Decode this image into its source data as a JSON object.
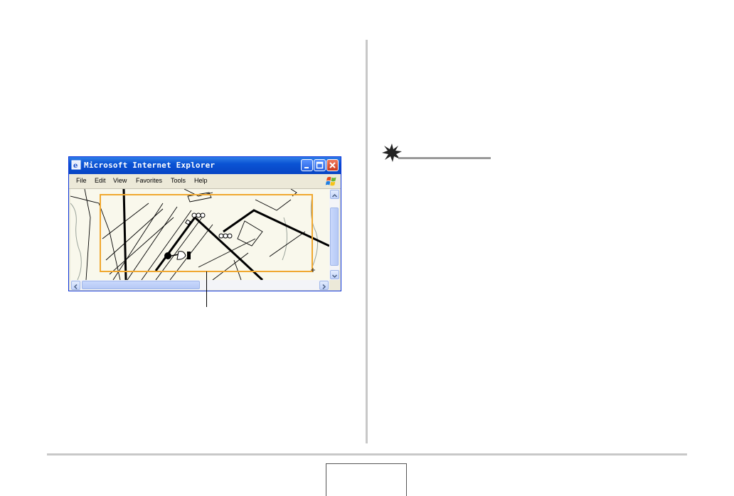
{
  "window": {
    "title": "Microsoft Internet Explorer",
    "controls": [
      "minimize-icon",
      "maximize-icon",
      "close-icon"
    ]
  },
  "menu": {
    "items": [
      "File",
      "Edit",
      "View",
      "Favorites",
      "Tools",
      "Help"
    ]
  },
  "map": {
    "selection_color": "#f0a830",
    "road_color": "#000000",
    "background_color": "#f9f8ec"
  },
  "page": {
    "number": ""
  },
  "important_marker": "burst-icon",
  "colors": {
    "titlebar": "#0a53d4",
    "divider": "#c8c8c8"
  }
}
